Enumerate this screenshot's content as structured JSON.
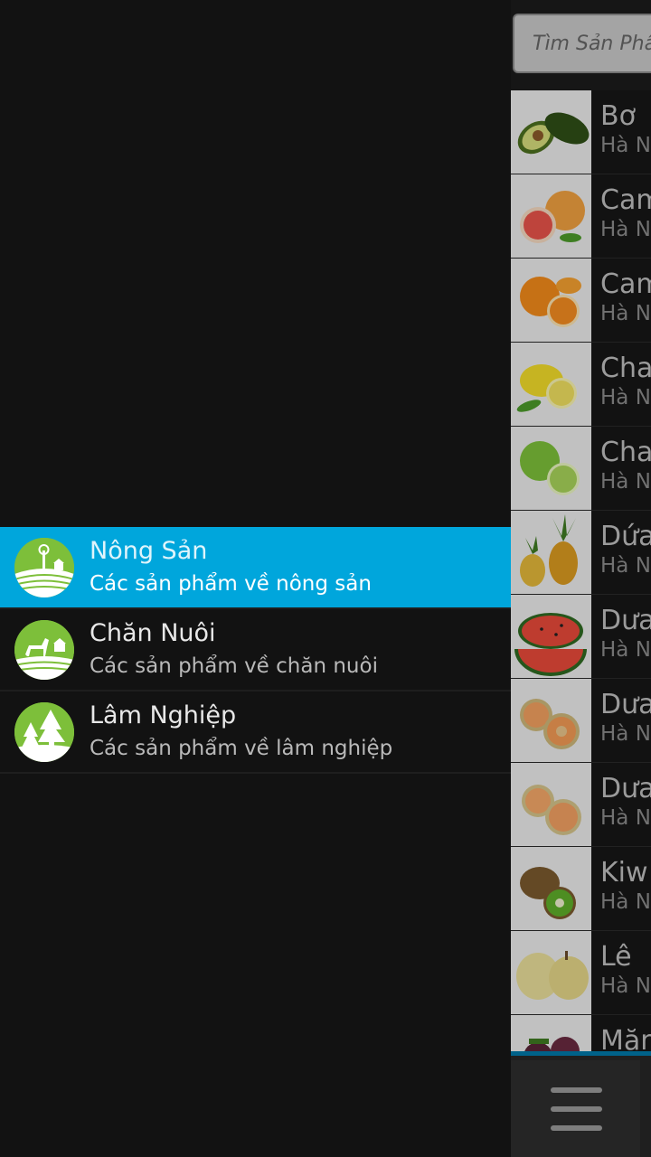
{
  "drawer": {
    "items": [
      {
        "title": "Nông Sản",
        "subtitle": "Các sản phẩm về nông sản",
        "icon": "farm-windmill-icon",
        "active": true
      },
      {
        "title": "Chăn Nuôi",
        "subtitle": "Các sản phẩm về chăn nuôi",
        "icon": "horse-farm-icon",
        "active": false
      },
      {
        "title": "Lâm Nghiệp",
        "subtitle": "Các sản phẩm về lâm nghiệp",
        "icon": "pine-trees-icon",
        "active": false
      }
    ]
  },
  "search": {
    "placeholder": "Tìm Sản Phẩm"
  },
  "products": [
    {
      "name": "Bơ",
      "location": "Hà N",
      "icon": "avocado"
    },
    {
      "name": "Cam",
      "location": "Hà N",
      "icon": "grapefruit"
    },
    {
      "name": "Cam",
      "location": "Hà N",
      "icon": "orange"
    },
    {
      "name": "Cha",
      "location": "Hà N",
      "icon": "lemon"
    },
    {
      "name": "Cha",
      "location": "Hà N",
      "icon": "lime"
    },
    {
      "name": "Dứa",
      "location": "Hà N",
      "icon": "pineapple"
    },
    {
      "name": "Dưa",
      "location": "Hà N",
      "icon": "watermelon"
    },
    {
      "name": "Dưa",
      "location": "Hà N",
      "icon": "cantaloupe"
    },
    {
      "name": "Dưa",
      "location": "Hà N",
      "icon": "melon"
    },
    {
      "name": "Kiw",
      "location": "Hà N",
      "icon": "kiwi"
    },
    {
      "name": "Lê",
      "location": "Hà N",
      "icon": "pear"
    },
    {
      "name": "Măn",
      "location": "",
      "icon": "mangosteen"
    }
  ],
  "colors": {
    "accent": "#00a6dc",
    "icon_green": "#7dbf3a",
    "action_bar_border": "#0078a8"
  }
}
